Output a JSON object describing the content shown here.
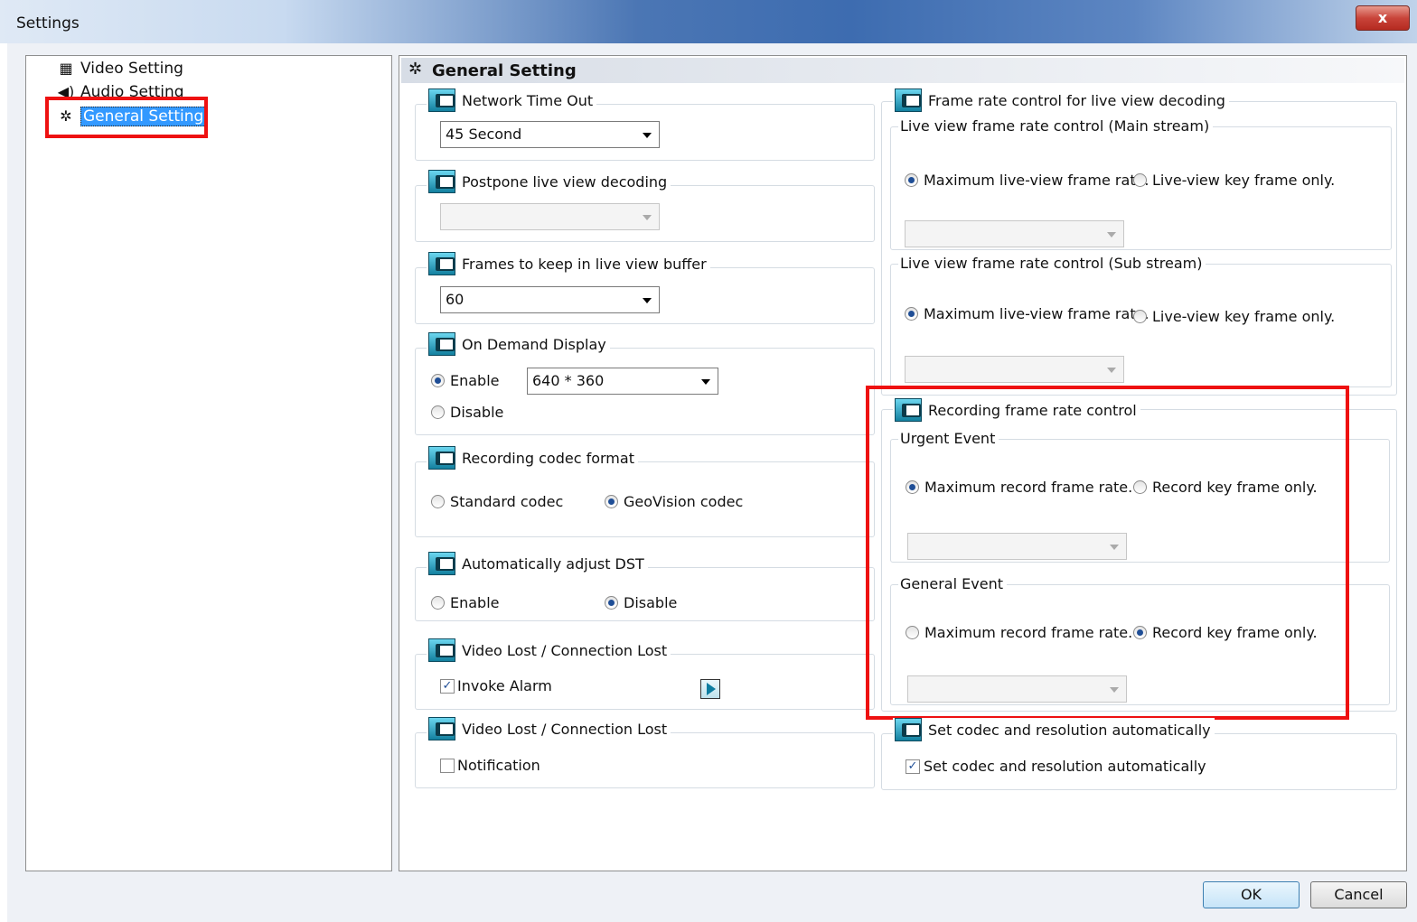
{
  "window": {
    "title": "Settings",
    "close_label": "x"
  },
  "tree": {
    "items": [
      {
        "label": "Video Setting",
        "icon": "film-icon"
      },
      {
        "label": "Audio Setting",
        "icon": "speaker-icon"
      },
      {
        "label": "General Setting",
        "icon": "gear-icon"
      }
    ]
  },
  "panel": {
    "title": "General Setting"
  },
  "network_timeout": {
    "title": "Network Time Out",
    "value": "45  Second"
  },
  "postpone": {
    "title": "Postpone live view decoding",
    "value": ""
  },
  "frames_buffer": {
    "title": "Frames to keep in live view buffer",
    "value": "60"
  },
  "on_demand": {
    "title": "On Demand Display",
    "enable": "Enable",
    "disable": "Disable",
    "resolution": "640 * 360"
  },
  "codec": {
    "title": "Recording codec format",
    "standard": "Standard codec",
    "geovision": "GeoVision codec"
  },
  "dst": {
    "title": "Automatically adjust DST",
    "enable": "Enable",
    "disable": "Disable"
  },
  "video_lost_alarm": {
    "title": "Video Lost / Connection Lost",
    "invoke": "Invoke Alarm"
  },
  "video_lost_notify": {
    "title": "Video Lost / Connection Lost",
    "notification": "Notification"
  },
  "live_decode": {
    "title": "Frame rate control for live view decoding",
    "main": {
      "title": "Live view frame rate control (Main stream)",
      "max": "Maximum live-view frame rate.",
      "key": "Live-view key frame only."
    },
    "sub": {
      "title": "Live view frame rate control (Sub stream)",
      "max": "Maximum live-view frame rate.",
      "key": "Live-view key frame only."
    }
  },
  "recording_rate": {
    "title": "Recording frame rate control",
    "urgent": {
      "title": "Urgent Event",
      "max": "Maximum record frame rate.",
      "key": "Record key frame only."
    },
    "general": {
      "title": "General Event",
      "max": "Maximum record frame rate.",
      "key": "Record key frame only."
    }
  },
  "auto_codec": {
    "title": "Set codec and resolution automatically",
    "check": "Set codec and resolution automatically"
  },
  "buttons": {
    "ok": "OK",
    "cancel": "Cancel"
  }
}
